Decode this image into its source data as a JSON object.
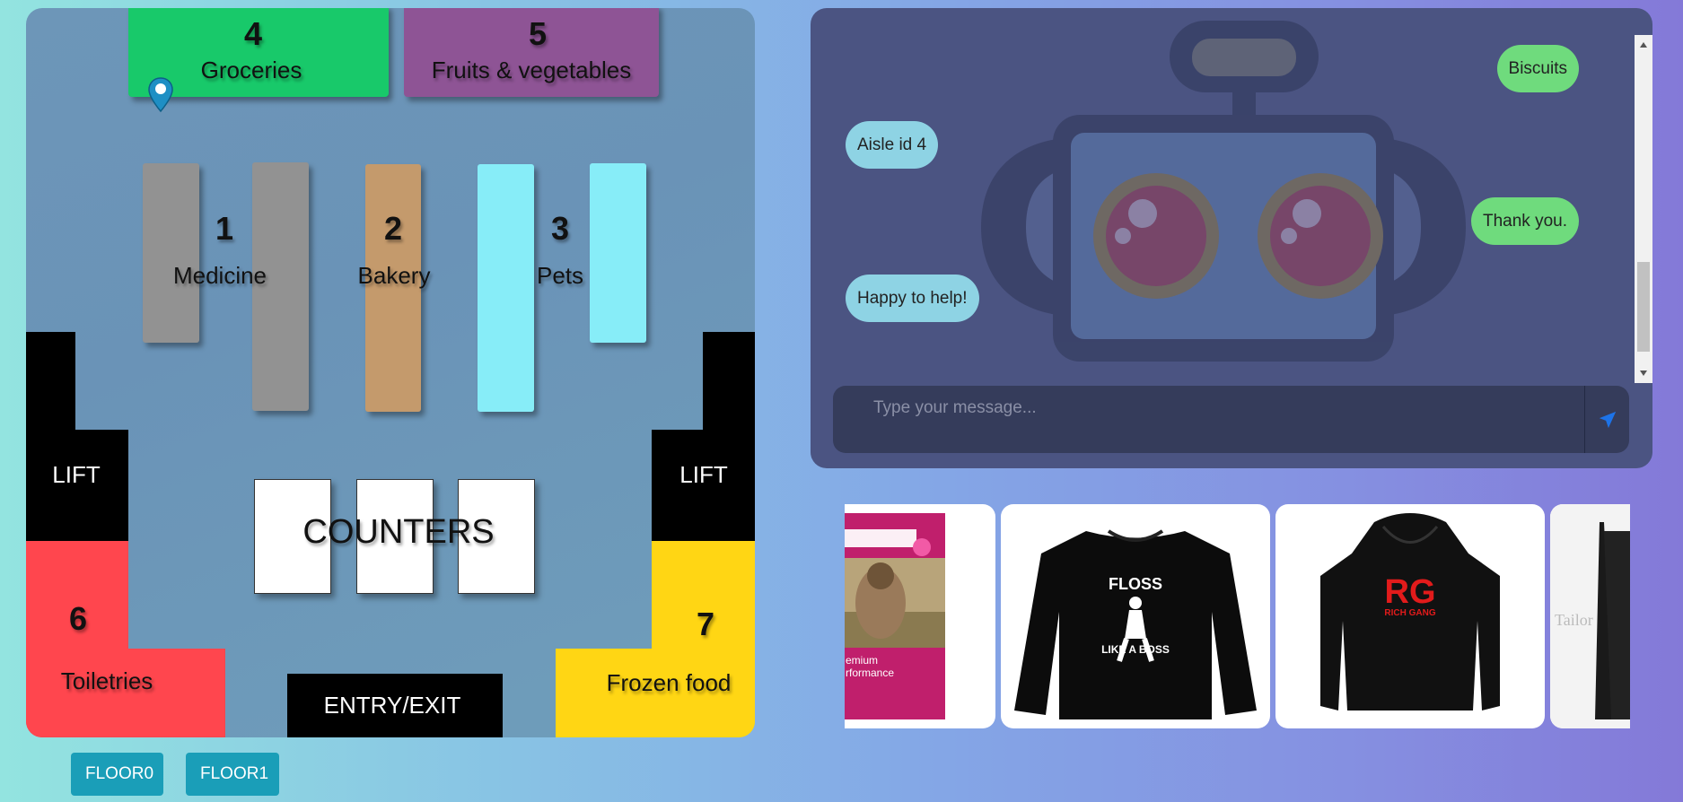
{
  "map": {
    "aisles": [
      {
        "id": "4",
        "name": "Groceries",
        "color": "#18c96a"
      },
      {
        "id": "5",
        "name": "Fruits & vegetables",
        "color": "#8e5495"
      },
      {
        "id": "1",
        "name": "Medicine",
        "color": "#929292"
      },
      {
        "id": "2",
        "name": "Bakery",
        "color": "#c49a6c"
      },
      {
        "id": "3",
        "name": "Pets",
        "color": "#87edf8"
      },
      {
        "id": "6",
        "name": "Toiletries",
        "color": "#ff464e"
      },
      {
        "id": "7",
        "name": "Frozen food",
        "color": "#ffd614"
      }
    ],
    "lift_left": "LIFT",
    "lift_right": "LIFT",
    "counters": "COUNTERS",
    "entry": "ENTRY/EXIT"
  },
  "floors": [
    "FLOOR0",
    "FLOOR1"
  ],
  "chat": {
    "messages": [
      {
        "from": "user",
        "text": "Biscuits"
      },
      {
        "from": "bot",
        "text": "Aisle id 4"
      },
      {
        "from": "user",
        "text": "Thank you."
      },
      {
        "from": "bot",
        "text": "Happy to help!"
      }
    ],
    "placeholder": "Type your message...",
    "send_icon": "send-icon",
    "user_color": "#6fdb7d",
    "bot_color": "#8ed3e4"
  },
  "products": {
    "items": [
      {
        "type": "dog-food-bag",
        "text": "emium\nrformance"
      },
      {
        "type": "sweatshirt",
        "line1": "FLOSS",
        "line2": "LIKE A BOSS"
      },
      {
        "type": "hoodie",
        "logo": "RG",
        "sub": "RICH GANG"
      },
      {
        "type": "shirt-partial",
        "text": "Tailor"
      }
    ]
  }
}
